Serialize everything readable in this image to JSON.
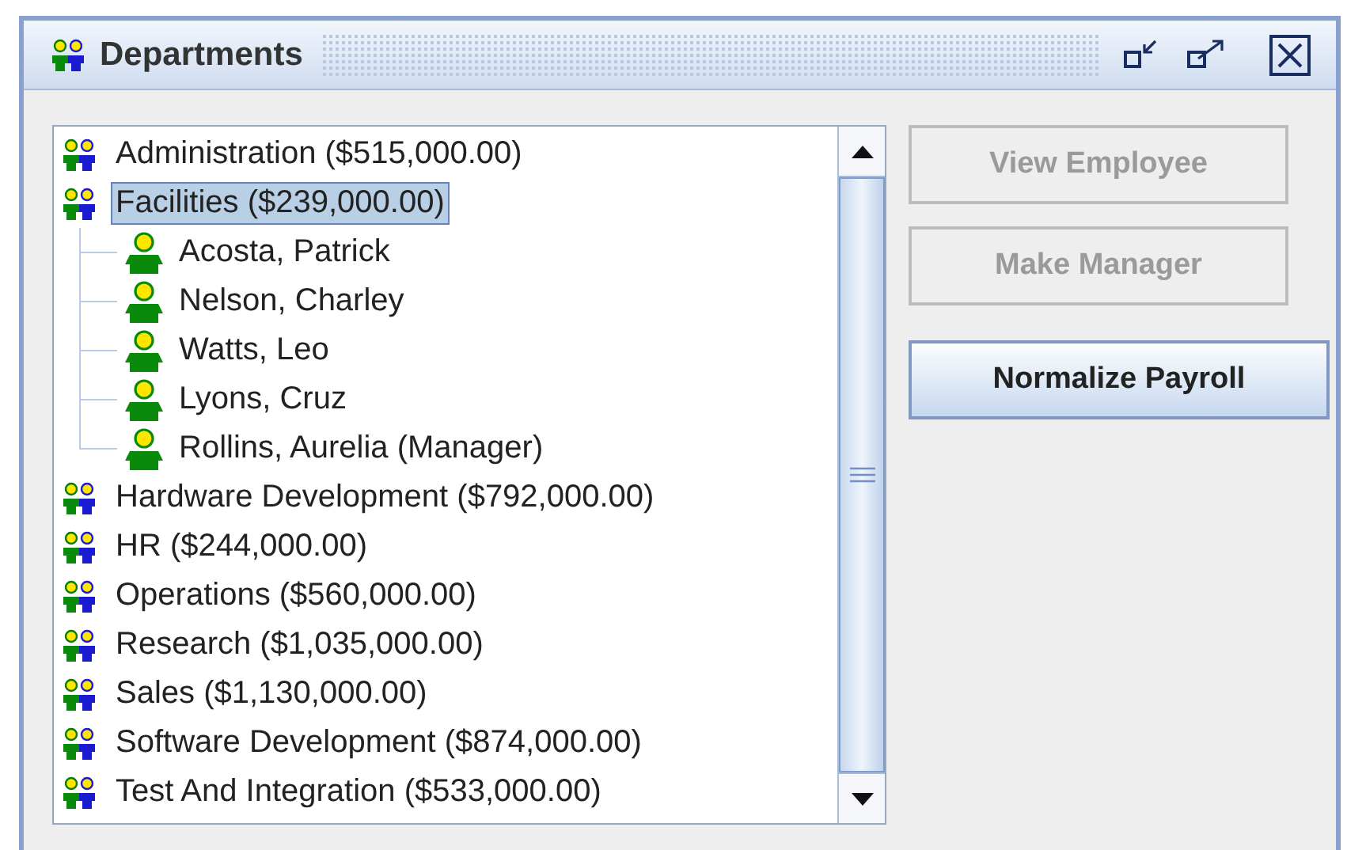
{
  "window": {
    "title": "Departments"
  },
  "tree": [
    {
      "kind": "department",
      "label": "Administration ($515,000.00)",
      "selected": false
    },
    {
      "kind": "department",
      "label": "Facilities ($239,000.00)",
      "selected": true,
      "children": [
        {
          "kind": "employee",
          "label": "Acosta, Patrick",
          "selected": false
        },
        {
          "kind": "employee",
          "label": "Nelson, Charley",
          "selected": false
        },
        {
          "kind": "employee",
          "label": "Watts, Leo",
          "selected": false
        },
        {
          "kind": "employee",
          "label": "Lyons, Cruz",
          "selected": false
        },
        {
          "kind": "employee",
          "label": "Rollins, Aurelia (Manager)",
          "selected": false
        }
      ]
    },
    {
      "kind": "department",
      "label": "Hardware Development ($792,000.00)",
      "selected": false
    },
    {
      "kind": "department",
      "label": "HR ($244,000.00)",
      "selected": false
    },
    {
      "kind": "department",
      "label": "Operations ($560,000.00)",
      "selected": false
    },
    {
      "kind": "department",
      "label": "Research ($1,035,000.00)",
      "selected": false
    },
    {
      "kind": "department",
      "label": "Sales ($1,130,000.00)",
      "selected": false
    },
    {
      "kind": "department",
      "label": "Software Development ($874,000.00)",
      "selected": false
    },
    {
      "kind": "department",
      "label": "Test And Integration ($533,000.00)",
      "selected": false
    }
  ],
  "buttons": [
    {
      "label": "View Employee",
      "disabled": true
    },
    {
      "label": "Make Manager",
      "disabled": true
    },
    {
      "label": "Normalize Payroll",
      "disabled": false
    }
  ]
}
